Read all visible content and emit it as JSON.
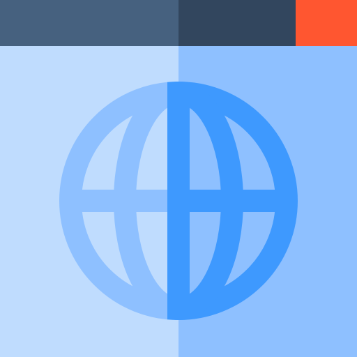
{
  "icon": {
    "name": "web-browser-globe-icon",
    "colors": {
      "title_bar_left": "#46617f",
      "title_bar_right": "#32465e",
      "close_button": "#ff5630",
      "content_left": "#bfdcfe",
      "content_right": "#8ec0ff",
      "globe_left": "#8ec0ff",
      "globe_right": "#3e99fe"
    }
  }
}
